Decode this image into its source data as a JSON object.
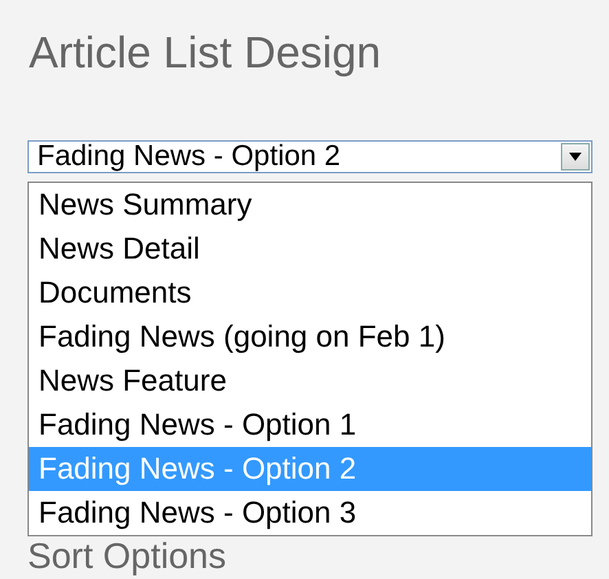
{
  "title": "Article List Design",
  "select": {
    "value": "Fading News - Option 2"
  },
  "options": [
    {
      "label": "News Summary",
      "selected": false
    },
    {
      "label": "News Detail",
      "selected": false
    },
    {
      "label": "Documents",
      "selected": false
    },
    {
      "label": "Fading News (going on Feb 1)",
      "selected": false
    },
    {
      "label": "News Feature",
      "selected": false
    },
    {
      "label": "Fading News - Option 1",
      "selected": false
    },
    {
      "label": "Fading News - Option 2",
      "selected": true
    },
    {
      "label": "Fading News - Option 3",
      "selected": false
    }
  ],
  "next_section": "Sort Options"
}
